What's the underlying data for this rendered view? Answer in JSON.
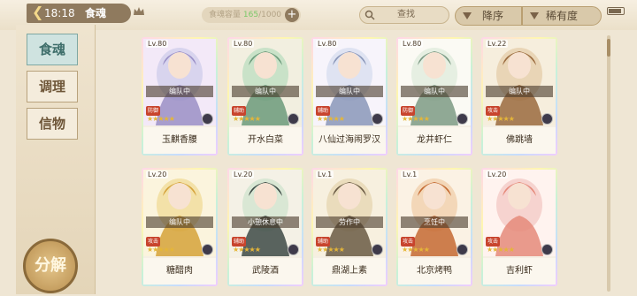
{
  "header": {
    "time": "18:18",
    "title": "食魂",
    "capacity_label": "食魂容量",
    "capacity_current": "165",
    "capacity_total": "/1000",
    "search_label": "查找",
    "sort_label": "降序",
    "sort_by_label": "稀有度"
  },
  "sidebar": {
    "items": [
      {
        "label": "食魂",
        "active": true
      },
      {
        "label": "调理",
        "active": false
      },
      {
        "label": "信物",
        "active": false
      }
    ],
    "decompose_label": "分解"
  },
  "cards": [
    {
      "level": "Lv.80",
      "status": "编队中",
      "role": "防御",
      "stars": 5,
      "name": "玉麒香腰",
      "palette": [
        "#d8d4ee",
        "#9a8fc6",
        "#f3e9f8"
      ]
    },
    {
      "level": "Lv.80",
      "status": "编队中",
      "role": "辅助",
      "stars": 5,
      "name": "开水白菜",
      "palette": [
        "#c9e2c8",
        "#6c9a7a",
        "#f2efe0"
      ]
    },
    {
      "level": "Lv.80",
      "status": "编队中",
      "role": "辅助",
      "stars": 5,
      "name": "八仙过海闹罗汉",
      "palette": [
        "#dfe3f2",
        "#8a96b8",
        "#f7f4fb"
      ]
    },
    {
      "level": "Lv.80",
      "status": "编队中",
      "role": "防御",
      "stars": 5,
      "name": "龙井虾仁",
      "palette": [
        "#e6efe2",
        "#7c9a84",
        "#fbfaf4"
      ]
    },
    {
      "level": "Lv.22",
      "status": "编队中",
      "role": "攻击",
      "stars": 5,
      "name": "佛跳墙",
      "palette": [
        "#e9d5b6",
        "#9a6a3e",
        "#f6eedd"
      ]
    },
    {
      "level": "Lv.20",
      "status": "编队中",
      "role": "攻击",
      "stars": 5,
      "name": "糖醋肉",
      "palette": [
        "#f3e1a8",
        "#d5a23a",
        "#fbf4dd"
      ]
    },
    {
      "level": "Lv.20",
      "status": "小憩休息中",
      "role": "辅助",
      "stars": 5,
      "name": "武陵酒",
      "palette": [
        "#d9e7d4",
        "#3d4a45",
        "#f4f1e6"
      ]
    },
    {
      "level": "Lv.1",
      "status": "劳作中",
      "role": "辅助",
      "stars": 5,
      "name": "鼎湖上素",
      "palette": [
        "#eadcbc",
        "#6a5a44",
        "#f7f0df"
      ]
    },
    {
      "level": "Lv.1",
      "status": "烹饪中",
      "role": "攻击",
      "stars": 5,
      "name": "北京烤鸭",
      "palette": [
        "#f3d7b8",
        "#c46a32",
        "#fbf2e4"
      ]
    },
    {
      "level": "Lv.20",
      "status": "",
      "role": "攻击",
      "stars": 5,
      "name": "吉利虾",
      "palette": [
        "#f6d3cf",
        "#e58a7a",
        "#fff3ef"
      ]
    }
  ]
}
